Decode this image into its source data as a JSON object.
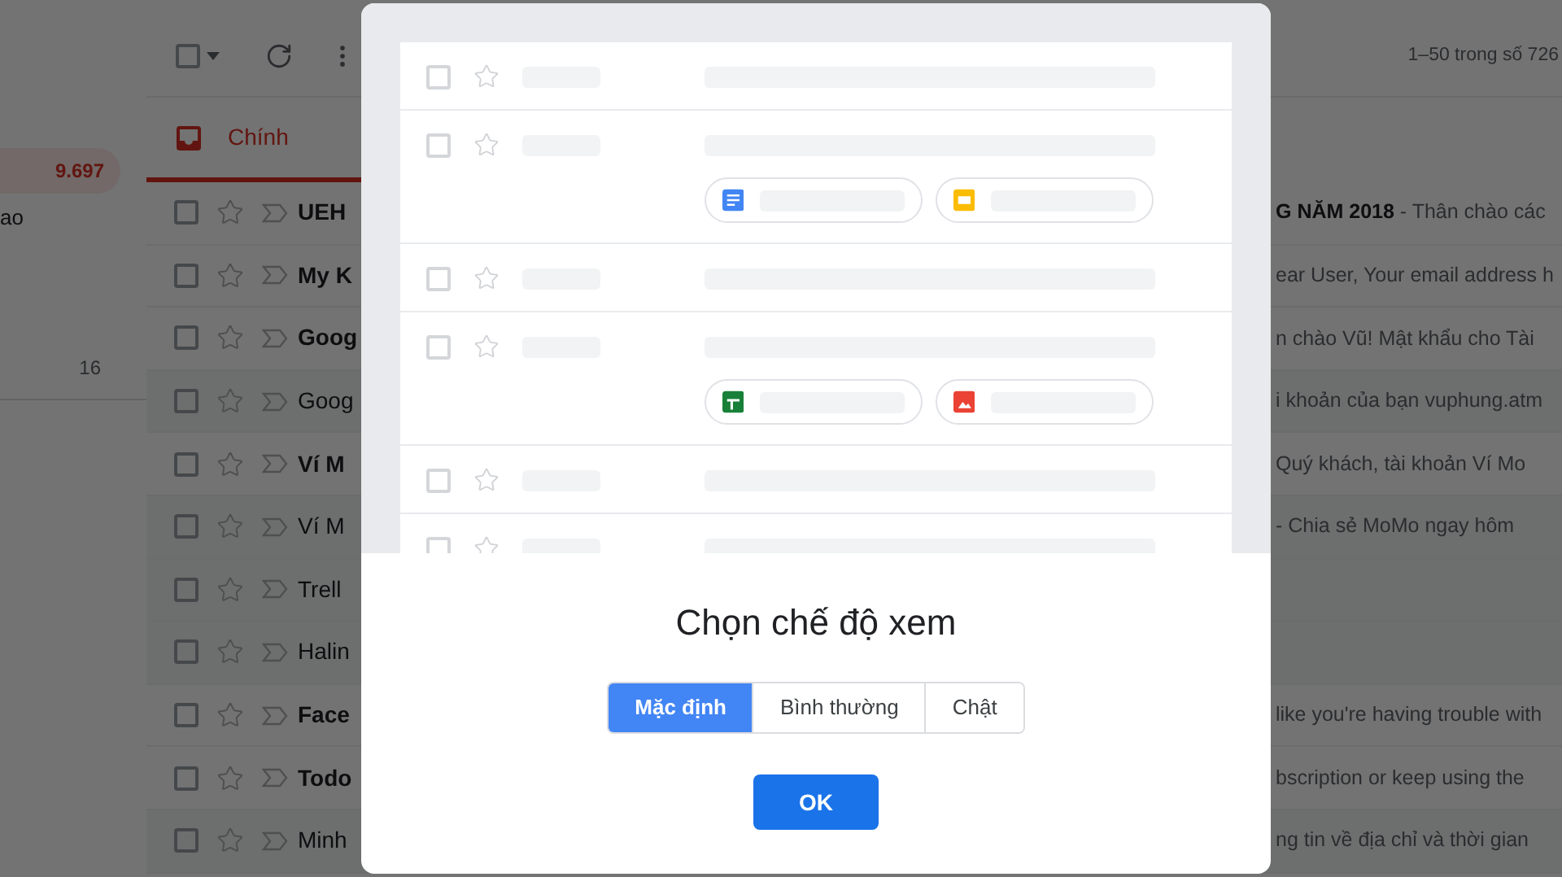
{
  "sidebar": {
    "inbox_count": "9.697",
    "label_fragment": "ao",
    "count": "16"
  },
  "toolbar": {
    "select_all_checked": false,
    "page_range": "1–50 trong số 726"
  },
  "tabs": [
    {
      "label": "Chính",
      "selected": true
    }
  ],
  "emails": [
    {
      "sender": "UEH",
      "snippet": "**G NĂM 2018** - Thân chào các",
      "unread": true,
      "checked": false
    },
    {
      "sender": "My K",
      "snippet": "ear User, Your email address h",
      "unread": true,
      "checked": false
    },
    {
      "sender": "Goog",
      "snippet": "n chào Vũ! Mật khẩu cho Tài",
      "unread": true,
      "checked": false
    },
    {
      "sender": "Goog",
      "snippet": "i khoản của bạn vuphung.atm",
      "unread": false,
      "checked": false
    },
    {
      "sender": "Ví M",
      "snippet": "Quý khách, tài khoản Ví Mo",
      "unread": true,
      "checked": false
    },
    {
      "sender": "Ví M",
      "snippet": "- Chia sẻ MoMo ngay hôm",
      "unread": false,
      "checked": false
    },
    {
      "sender": "Trell",
      "unread": false,
      "checked": false
    },
    {
      "sender": "Halin",
      "unread": false,
      "checked": false
    },
    {
      "sender": "Face",
      "snippet": "like you're having trouble with",
      "unread": true,
      "checked": false
    },
    {
      "sender": "Todo",
      "snippet": "bscription or keep using the",
      "unread": true,
      "checked": false
    },
    {
      "sender": "Minh",
      "snippet": "ng tin về địa chỉ và thời gian",
      "unread": false,
      "checked": false
    }
  ],
  "dialog": {
    "title": "Chọn chế độ xem",
    "view_modes": [
      {
        "label": "Mặc định",
        "selected": true
      },
      {
        "label": "Bình thường",
        "selected": false
      },
      {
        "label": "Chật",
        "selected": false
      }
    ],
    "ok_button": "OK"
  }
}
